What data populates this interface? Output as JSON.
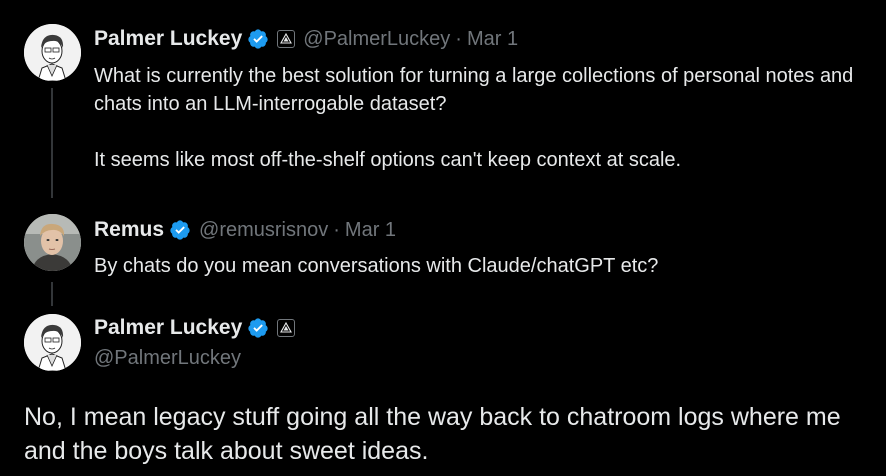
{
  "tweets": [
    {
      "name": "Palmer Luckey",
      "handle": "@PalmerLuckey",
      "separator": "·",
      "date": "Mar 1",
      "verified": true,
      "affiliation_icon": "anduril-logo-icon",
      "text": [
        "What is currently the best solution for turning a large collections of personal notes and chats into an LLM-interrogable dataset?",
        "It seems like most off-the-shelf options can't keep context at scale."
      ]
    },
    {
      "name": "Remus",
      "handle": "@remusrisnov",
      "separator": "·",
      "date": "Mar 1",
      "verified": true,
      "text": [
        "By chats do you mean conversations with Claude/chatGPT etc?"
      ]
    }
  ],
  "main_tweet": {
    "name": "Palmer Luckey",
    "handle": "@PalmerLuckey",
    "verified": true,
    "affiliation_icon": "anduril-logo-icon",
    "text": "No, I mean legacy stuff going all the way back to chatroom logs where me and the boys talk about sweet ideas."
  },
  "colors": {
    "background": "#000000",
    "text": "#e7e9ea",
    "muted": "#71767b",
    "verified_blue": "#1d9bf0",
    "thread_line": "#333639"
  }
}
